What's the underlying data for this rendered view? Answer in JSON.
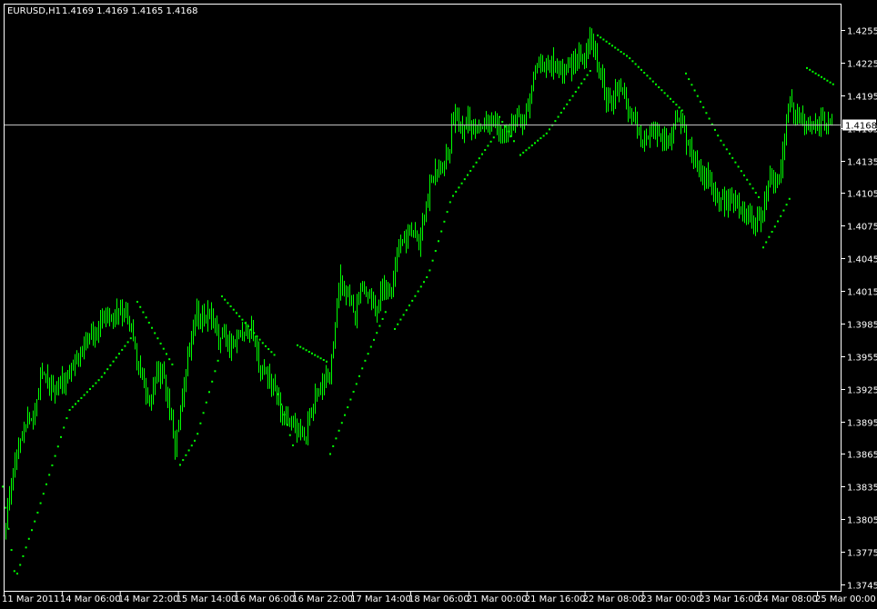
{
  "header": {
    "symbol": "EURUSD,H1",
    "ohlc": "1.4169 1.4169 1.4165 1.4168"
  },
  "colors": {
    "background": "#000000",
    "frame": "#ffffff",
    "candle": "#00ff00",
    "sar": "#00ff00",
    "text": "#ffffff",
    "price_line": "#c0c0c0",
    "price_tag_bg": "#ffffff",
    "price_tag_text": "#000000"
  },
  "chart_data": {
    "type": "candlestick",
    "symbol": "EURUSD",
    "timeframe": "H1",
    "ylim": [
      1.3735,
      1.4275
    ],
    "y_ticks": [
      "1.4255",
      "1.4225",
      "1.4195",
      "1.4165",
      "1.4135",
      "1.4105",
      "1.4075",
      "1.4045",
      "1.4015",
      "1.3985",
      "1.3955",
      "1.3925",
      "1.3895",
      "1.3865",
      "1.3835",
      "1.3805",
      "1.3775",
      "1.3745"
    ],
    "x_ticks": [
      "11 Mar 2011",
      "14 Mar 06:00",
      "14 Mar 22:00",
      "15 Mar 14:00",
      "16 Mar 06:00",
      "16 Mar 22:00",
      "17 Mar 14:00",
      "18 Mar 06:00",
      "21 Mar 00:00",
      "21 Mar 16:00",
      "22 Mar 08:00",
      "23 Mar 00:00",
      "23 Mar 16:00",
      "24 Mar 08:00",
      "25 Mar 00:00"
    ],
    "current_price": "1.4168",
    "close_path": [
      [
        0,
        1.3775
      ],
      [
        6,
        1.38
      ],
      [
        14,
        1.385
      ],
      [
        22,
        1.388
      ],
      [
        30,
        1.39
      ],
      [
        38,
        1.39
      ],
      [
        44,
        1.3945
      ],
      [
        52,
        1.3935
      ],
      [
        60,
        1.392
      ],
      [
        68,
        1.393
      ],
      [
        76,
        1.3935
      ],
      [
        84,
        1.3955
      ],
      [
        92,
        1.3965
      ],
      [
        100,
        1.3975
      ],
      [
        108,
        1.3985
      ],
      [
        116,
        1.3995
      ],
      [
        124,
        1.3995
      ],
      [
        132,
        1.3995
      ],
      [
        140,
        1.3995
      ],
      [
        148,
        1.396
      ],
      [
        156,
        1.393
      ],
      [
        164,
        1.391
      ],
      [
        170,
        1.393
      ],
      [
        178,
        1.394
      ],
      [
        186,
        1.39
      ],
      [
        192,
        1.3875
      ],
      [
        198,
        1.39
      ],
      [
        206,
        1.395
      ],
      [
        214,
        1.399
      ],
      [
        222,
        1.3995
      ],
      [
        230,
        1.399
      ],
      [
        238,
        1.3975
      ],
      [
        246,
        1.397
      ],
      [
        254,
        1.3965
      ],
      [
        262,
        1.3975
      ],
      [
        270,
        1.398
      ],
      [
        278,
        1.3975
      ],
      [
        286,
        1.394
      ],
      [
        294,
        1.3935
      ],
      [
        302,
        1.3925
      ],
      [
        310,
        1.39
      ],
      [
        318,
        1.3895
      ],
      [
        326,
        1.389
      ],
      [
        332,
        1.388
      ],
      [
        338,
        1.389
      ],
      [
        346,
        1.392
      ],
      [
        354,
        1.3925
      ],
      [
        362,
        1.394
      ],
      [
        368,
        1.398
      ],
      [
        374,
        1.4025
      ],
      [
        382,
        1.401
      ],
      [
        390,
        1.3995
      ],
      [
        398,
        1.4015
      ],
      [
        406,
        1.401
      ],
      [
        414,
        1.4
      ],
      [
        422,
        1.402
      ],
      [
        430,
        1.401
      ],
      [
        436,
        1.406
      ],
      [
        444,
        1.4065
      ],
      [
        452,
        1.407
      ],
      [
        460,
        1.406
      ],
      [
        468,
        1.4095
      ],
      [
        476,
        1.4125
      ],
      [
        484,
        1.4135
      ],
      [
        492,
        1.414
      ],
      [
        498,
        1.4175
      ],
      [
        506,
        1.4165
      ],
      [
        514,
        1.4175
      ],
      [
        522,
        1.4165
      ],
      [
        530,
        1.417
      ],
      [
        538,
        1.417
      ],
      [
        546,
        1.4165
      ],
      [
        552,
        1.416
      ],
      [
        560,
        1.4165
      ],
      [
        568,
        1.4175
      ],
      [
        576,
        1.4175
      ],
      [
        584,
        1.42
      ],
      [
        592,
        1.423
      ],
      [
        600,
        1.422
      ],
      [
        608,
        1.4225
      ],
      [
        616,
        1.4215
      ],
      [
        624,
        1.422
      ],
      [
        632,
        1.4225
      ],
      [
        640,
        1.423
      ],
      [
        648,
        1.424
      ],
      [
        654,
        1.4235
      ],
      [
        660,
        1.4215
      ],
      [
        666,
        1.419
      ],
      [
        674,
        1.4195
      ],
      [
        682,
        1.42
      ],
      [
        690,
        1.418
      ],
      [
        698,
        1.4175
      ],
      [
        706,
        1.415
      ],
      [
        714,
        1.416
      ],
      [
        722,
        1.4165
      ],
      [
        730,
        1.4155
      ],
      [
        738,
        1.416
      ],
      [
        746,
        1.4175
      ],
      [
        752,
        1.416
      ],
      [
        758,
        1.4145
      ],
      [
        766,
        1.413
      ],
      [
        774,
        1.412
      ],
      [
        782,
        1.4115
      ],
      [
        790,
        1.41
      ],
      [
        798,
        1.4095
      ],
      [
        806,
        1.41
      ],
      [
        814,
        1.4085
      ],
      [
        822,
        1.408
      ],
      [
        830,
        1.4075
      ],
      [
        838,
        1.4085
      ],
      [
        846,
        1.4115
      ],
      [
        854,
        1.412
      ],
      [
        860,
        1.414
      ],
      [
        866,
        1.4185
      ],
      [
        872,
        1.418
      ],
      [
        880,
        1.417
      ],
      [
        888,
        1.4165
      ],
      [
        896,
        1.4165
      ],
      [
        904,
        1.417
      ],
      [
        912,
        1.4168
      ]
    ],
    "sar_segments": [
      [
        [
          2,
          1.3835
        ],
        [
          16,
          1.375
        ],
        [
          40,
          1.381
        ],
        [
          75,
          1.3905
        ],
        [
          110,
          1.3935
        ],
        [
          146,
          1.3975
        ]
      ],
      [
        [
          150,
          1.4005
        ],
        [
          160,
          1.399
        ],
        [
          190,
          1.3945
        ]
      ],
      [
        [
          197,
          1.3855
        ],
        [
          215,
          1.388
        ],
        [
          240,
          1.3955
        ]
      ],
      [
        [
          243,
          1.401
        ],
        [
          290,
          1.3965
        ],
        [
          302,
          1.3955
        ]
      ],
      [
        [
          305,
          1.392
        ],
        [
          322,
          1.387
        ]
      ],
      [
        [
          326,
          1.3965
        ],
        [
          358,
          1.395
        ]
      ],
      [
        [
          362,
          1.3865
        ],
        [
          400,
          1.395
        ],
        [
          425,
          1.4
        ]
      ],
      [
        [
          433,
          1.398
        ],
        [
          470,
          1.403
        ],
        [
          495,
          1.41
        ],
        [
          545,
          1.416
        ]
      ],
      [
        [
          548,
          1.4175
        ],
        [
          566,
          1.415
        ]
      ],
      [
        [
          571,
          1.414
        ],
        [
          600,
          1.416
        ],
        [
          650,
          1.422
        ]
      ],
      [
        [
          656,
          1.425
        ],
        [
          690,
          1.423
        ],
        [
          750,
          1.418
        ]
      ],
      [
        [
          753,
          1.4215
        ],
        [
          790,
          1.4155
        ],
        [
          834,
          1.41
        ]
      ],
      [
        [
          838,
          1.4055
        ],
        [
          858,
          1.4085
        ],
        [
          870,
          1.4105
        ]
      ],
      [
        [
          886,
          1.422
        ],
        [
          915,
          1.4205
        ]
      ]
    ]
  }
}
